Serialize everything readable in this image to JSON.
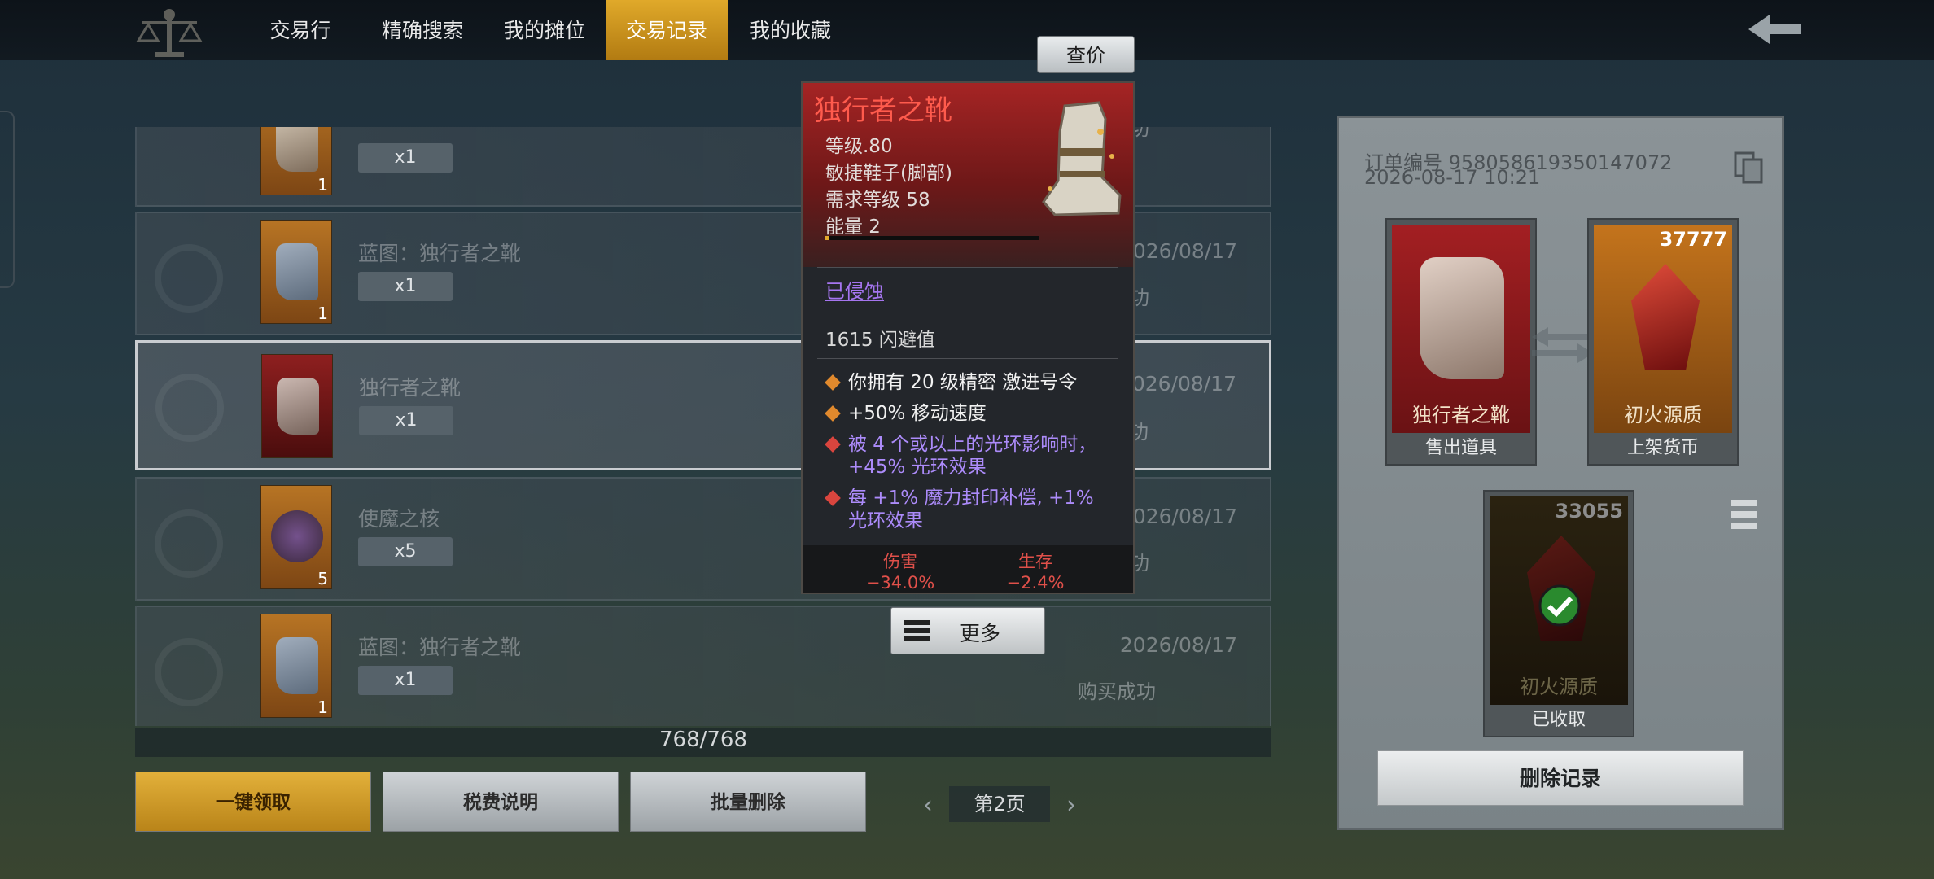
{
  "nav": {
    "tabs": [
      {
        "label": "交易行"
      },
      {
        "label": "精确搜索"
      },
      {
        "label": "我的摊位"
      },
      {
        "label": "交易记录",
        "active": true
      },
      {
        "label": "我的收藏"
      }
    ],
    "accent": "#d29a1f"
  },
  "list": {
    "rows": [
      {
        "name": "",
        "qty": "x1",
        "count": "1",
        "date": "",
        "status": "买成功"
      },
      {
        "name": "蓝图：独行者之靴",
        "qty": "x1",
        "count": "1",
        "date": "026/08/17",
        "status": "买成功"
      },
      {
        "name": "独行者之靴",
        "qty": "x1",
        "count": "",
        "date": "026/08/17",
        "status": "售成功",
        "selected": true
      },
      {
        "name": "使魔之核",
        "qty": "x5",
        "count": "5",
        "date": "026/08/17",
        "status": "买成功"
      },
      {
        "name": "蓝图：独行者之靴",
        "qty": "x1",
        "count": "1",
        "date": "2026/08/17",
        "status": "购买成功"
      }
    ],
    "total": "768/768"
  },
  "buttons": {
    "claim_all": "一键领取",
    "tax_info": "税费说明",
    "batch_delete": "批量删除"
  },
  "pagination": {
    "label": "第2页"
  },
  "order": {
    "number": "订单编号 958058619350147072",
    "time": "2026-08-17 10:21",
    "sold_item": {
      "name": "独行者之靴",
      "caption": "售出道具"
    },
    "listing_currency": {
      "name": "初火源质",
      "amount": "37777",
      "caption": "上架货币"
    },
    "received": {
      "name": "初火源质",
      "amount": "33055",
      "caption": "已收取"
    },
    "delete_label": "删除记录"
  },
  "tooltip": {
    "price_check": "查价",
    "title": "独行者之靴",
    "level": "等级.80",
    "type": "敏捷鞋子(脚部)",
    "req_level": "需求等级 58",
    "energy": "能量 2",
    "energy_fraction": 0.02,
    "corrupted": "已侵蚀",
    "dodge": "1615 闪避值",
    "affixes": [
      {
        "text": "你拥有 20 级精密 激进号令",
        "color": "#e0892d",
        "style": "normal"
      },
      {
        "text": "+50% 移动速度",
        "color": "#e0892d",
        "style": "normal"
      },
      {
        "text": "被 4 个或以上的光环影响时，+45% 光环效果",
        "color": "#d9453e",
        "style": "purple"
      },
      {
        "text": "每 +1% 魔力封印补偿, +1% 光环效果",
        "color": "#d9453e",
        "style": "purple"
      }
    ],
    "damage_label": "伤害",
    "damage_value": "−34.0%",
    "survival_label": "生存",
    "survival_value": "−2.4%",
    "more": "更多"
  }
}
